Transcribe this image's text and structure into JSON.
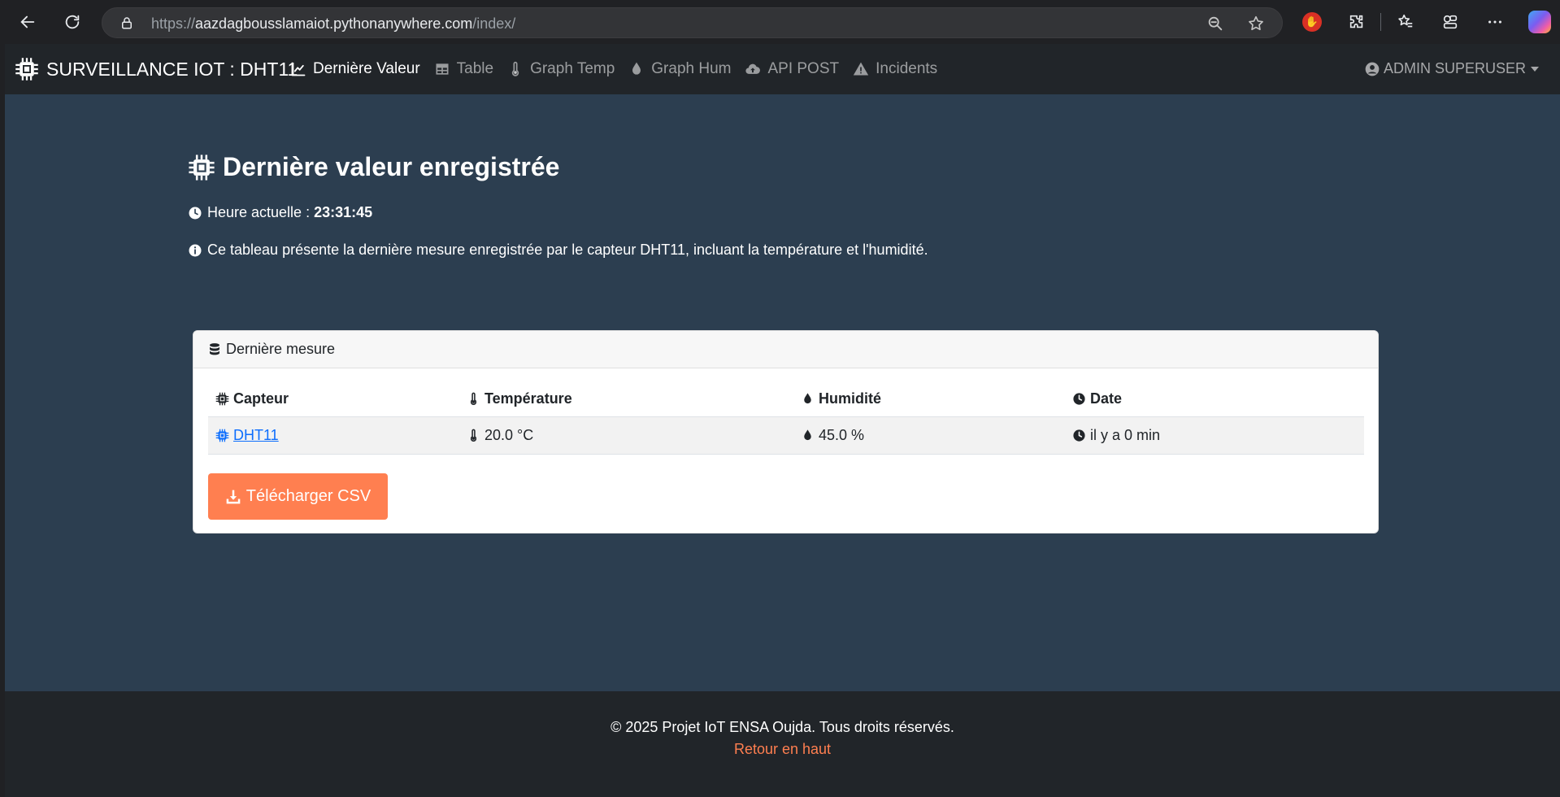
{
  "browser": {
    "url_prefix": "https://",
    "url_host": "aazdagbousslamaiot.pythonanywhere.com",
    "url_path": "/index/"
  },
  "navbar": {
    "brand": "SURVEILLANCE IOT : DHT11",
    "items": [
      {
        "label": "Dernière Valeur",
        "icon": "chart-line-icon",
        "active": true
      },
      {
        "label": "Table",
        "icon": "table-icon",
        "active": false
      },
      {
        "label": "Graph Temp",
        "icon": "thermometer-icon",
        "active": false
      },
      {
        "label": "Graph Hum",
        "icon": "droplet-icon",
        "active": false
      },
      {
        "label": "API POST",
        "icon": "cloud-upload-icon",
        "active": false
      },
      {
        "label": "Incidents",
        "icon": "warning-icon",
        "active": false
      }
    ],
    "user": "ADMIN SUPERUSER"
  },
  "main": {
    "title": "Dernière valeur enregistrée",
    "clock_label": "Heure actuelle :",
    "clock_value": "23:31:45",
    "info": "Ce tableau présente la dernière mesure enregistrée par le capteur DHT11, incluant la température et l'humidité."
  },
  "card": {
    "header": "Dernière mesure",
    "columns": [
      "Capteur",
      "Température",
      "Humidité",
      "Date"
    ],
    "row": {
      "sensor": "DHT11",
      "temperature": "20.0 °C",
      "humidity": "45.0 %",
      "date": "il y a 0 min"
    },
    "csv_button": "Télécharger CSV"
  },
  "footer": {
    "text": "© 2025 Projet IoT ENSA Oujda. Tous droits réservés.",
    "link": "Retour en haut"
  },
  "colors": {
    "page_bg": "#2c3e50",
    "navbar_bg": "#212529",
    "accent": "#ff7f50",
    "link": "#0d6efd"
  }
}
